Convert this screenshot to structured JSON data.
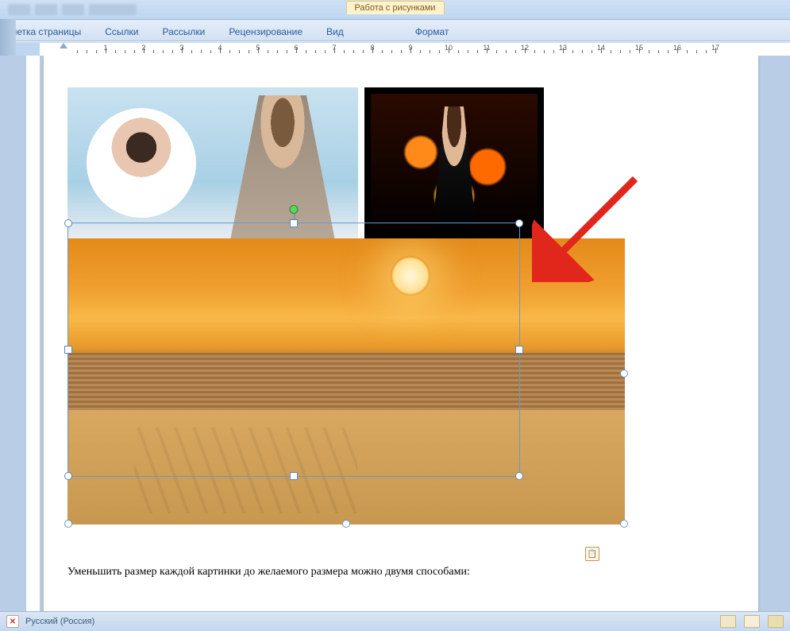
{
  "titlebar": {
    "contextual_label": "Работа с рисунками"
  },
  "ribbon": {
    "tabs": {
      "page_layout": "метка страницы",
      "references": "Ссылки",
      "mailings": "Рассылки",
      "review": "Рецензирование",
      "view": "Вид",
      "format": "Формат"
    }
  },
  "ruler": {
    "marks": [
      1,
      2,
      3,
      4,
      5,
      6,
      7,
      8,
      9,
      10,
      11,
      12,
      13,
      14,
      15,
      16,
      17
    ]
  },
  "document": {
    "body_text": "Уменьшить размер каждой картинки до желаемого размера можно двумя способами:",
    "paste_icon_name": "paste-options-icon"
  },
  "statusbar": {
    "language": "Русский (Россия)"
  }
}
